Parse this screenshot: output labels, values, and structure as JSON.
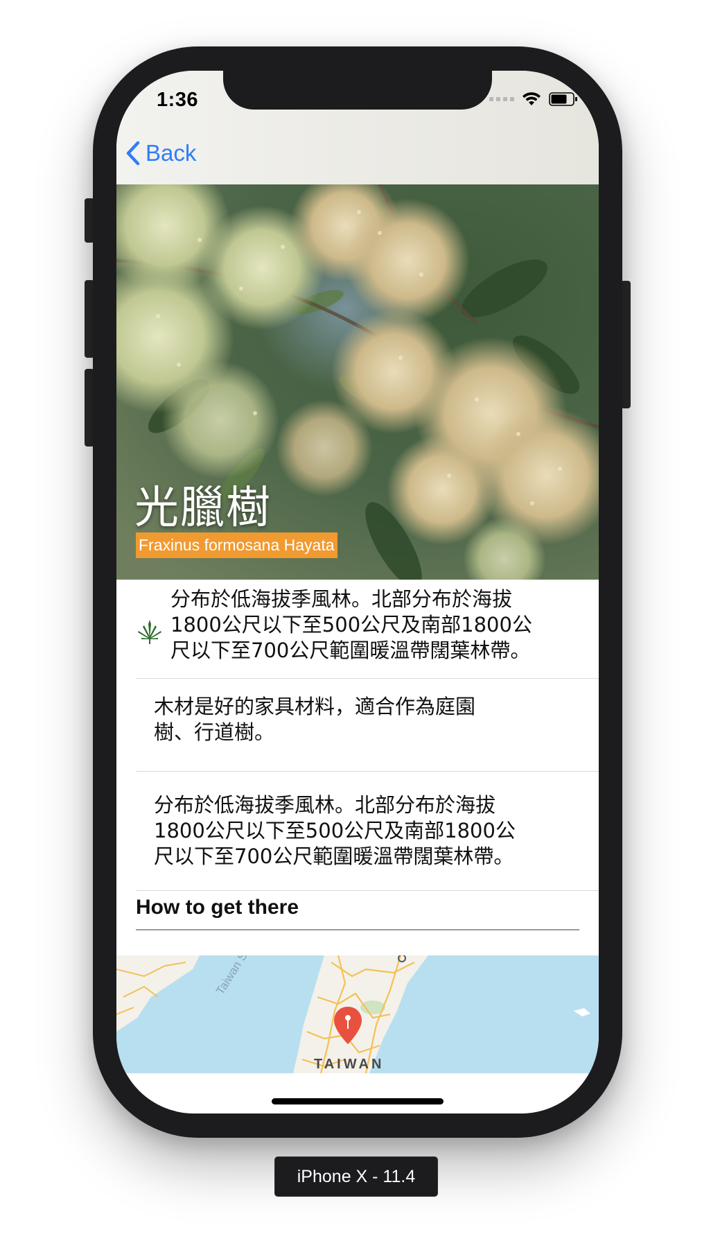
{
  "status_bar": {
    "time": "1:36"
  },
  "nav": {
    "back_label": "Back"
  },
  "hero": {
    "title": "光臘樹",
    "subtitle": "Fraxinus formosana Hayata"
  },
  "rows": [
    {
      "icon": "leaf-icon",
      "line1": "分布於低海拔季風林。北部分布於海拔",
      "line2": "1800公尺以下至500公尺及南部1800公",
      "line3": "尺以下至700公尺範圍暖溫帶闊葉林帶。"
    },
    {
      "line1": "木材是好的家具材料，適合作為庭園",
      "line2": "樹、行道樹。"
    },
    {
      "line1": "分布於低海拔季風林。北部分布於海拔",
      "line2": "1800公尺以下至500公尺及南部1800公",
      "line3": "尺以下至700公尺範圍暖溫帶闊葉林帶。"
    }
  ],
  "directions": {
    "heading": "How to get there"
  },
  "map": {
    "country_label": "TAIWAN",
    "strait_label": "Taiwan Str",
    "pin_icon": "map-pin-icon",
    "pin_color": "#e8513f",
    "water_color": "#b8dff0",
    "land_color": "#f3f1ea",
    "road_color": "#f5c054"
  },
  "theme": {
    "accent": "#2f7df6",
    "subtitle_bg": "#f19a30"
  },
  "simulator": {
    "device_label": "iPhone X - 11.4"
  }
}
